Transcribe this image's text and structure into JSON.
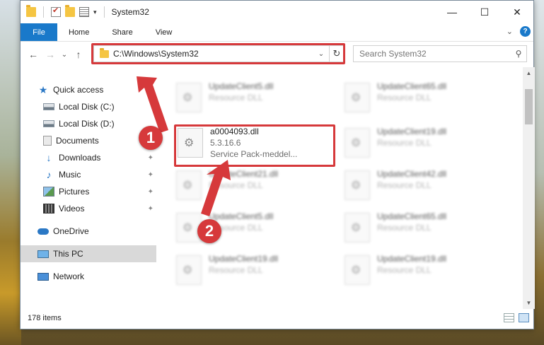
{
  "window": {
    "title": "System32",
    "controls": {
      "minimize": "—",
      "maximize": "☐",
      "close": "✕"
    }
  },
  "ribbon": {
    "tabs": [
      "File",
      "Home",
      "Share",
      "View"
    ],
    "collapse_caret": "⌄",
    "help": "?"
  },
  "nav": {
    "back": "←",
    "forward": "→",
    "recent": "⌄",
    "up": "↑",
    "address_path": "C:\\Windows\\System32",
    "address_chevron": "⌄",
    "refresh": "↻",
    "search_placeholder": "Search System32",
    "search_icon": "⚲"
  },
  "sidebar": {
    "items": [
      {
        "label": "Quick access",
        "icon": "star-icon",
        "level": 1,
        "pinned": false
      },
      {
        "label": "Local Disk (C:)",
        "icon": "drive-icon",
        "level": 2,
        "pinned": false
      },
      {
        "label": "Local Disk (D:)",
        "icon": "drive-icon",
        "level": 2,
        "pinned": false
      },
      {
        "label": "Documents",
        "icon": "documents-icon",
        "level": 2,
        "pinned": true
      },
      {
        "label": "Downloads",
        "icon": "download-icon",
        "level": 2,
        "pinned": true
      },
      {
        "label": "Music",
        "icon": "music-icon",
        "level": 2,
        "pinned": true
      },
      {
        "label": "Pictures",
        "icon": "pictures-icon",
        "level": 2,
        "pinned": true
      },
      {
        "label": "Videos",
        "icon": "videos-icon",
        "level": 2,
        "pinned": true
      },
      {
        "label": "OneDrive",
        "icon": "cloud-icon",
        "level": 1,
        "pinned": false
      },
      {
        "label": "This PC",
        "icon": "computer-icon",
        "level": 1,
        "pinned": false,
        "selected": true
      },
      {
        "label": "Network",
        "icon": "network-icon",
        "level": 1,
        "pinned": false
      }
    ],
    "pin_glyph": "📌"
  },
  "files": {
    "highlighted": {
      "name": "a0004093.dll",
      "version": "5.3.16.6",
      "description": "Service Pack-meddel..."
    },
    "blurred": [
      {
        "name": "UpdateClient5.dll",
        "type": "Resource DLL"
      },
      {
        "name": "UpdateClient65.dll",
        "type": "Resource DLL"
      },
      {
        "name": "UpdateClient19.dll",
        "type": "Resource DLL"
      },
      {
        "name": "UpdateClient21.dll",
        "type": "Resource DLL"
      },
      {
        "name": "UpdateClient42.dll",
        "type": "Resource DLL"
      },
      {
        "name": "UpdateClient5.dll",
        "type": "Resource DLL"
      },
      {
        "name": "UpdateClient65.dll",
        "type": "Resource DLL"
      },
      {
        "name": "UpdateClient19.dll",
        "type": "Resource DLL"
      },
      {
        "name": "UpdateClient19.dll",
        "type": "Resource DLL"
      }
    ]
  },
  "status": {
    "item_count": "178 items"
  },
  "callouts": {
    "one": "1",
    "two": "2"
  },
  "colors": {
    "accent": "#1979ca",
    "highlight": "#d6393b"
  }
}
